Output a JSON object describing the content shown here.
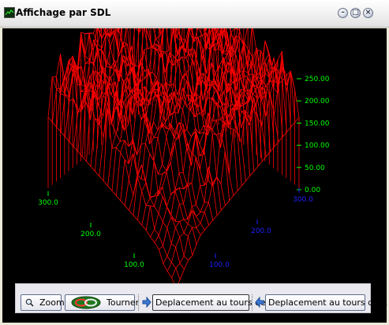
{
  "window": {
    "title": "Affichage par SDL"
  },
  "plot": {
    "surface_color": "#ff0000",
    "vertical_axis_ticks": [
      "250.00",
      "200.00",
      "150.00",
      "100.00",
      "50.00",
      "0.00"
    ],
    "left_axis_ticks": [
      "300.0",
      "200.0",
      "100.0"
    ],
    "right_axis_ticks": [
      "300.0",
      "200.0",
      "100.0"
    ],
    "vertical_axis_color": "#00ff00",
    "left_axis_color": "#00ff00",
    "right_axis_color": "#2020ff"
  },
  "toolbar": {
    "zoom_label": "Zoom",
    "rotate_label": "Tourner",
    "move_z_label": "Deplacement au tours de Z",
    "move_x_label": "Deplacement au tours de X"
  }
}
